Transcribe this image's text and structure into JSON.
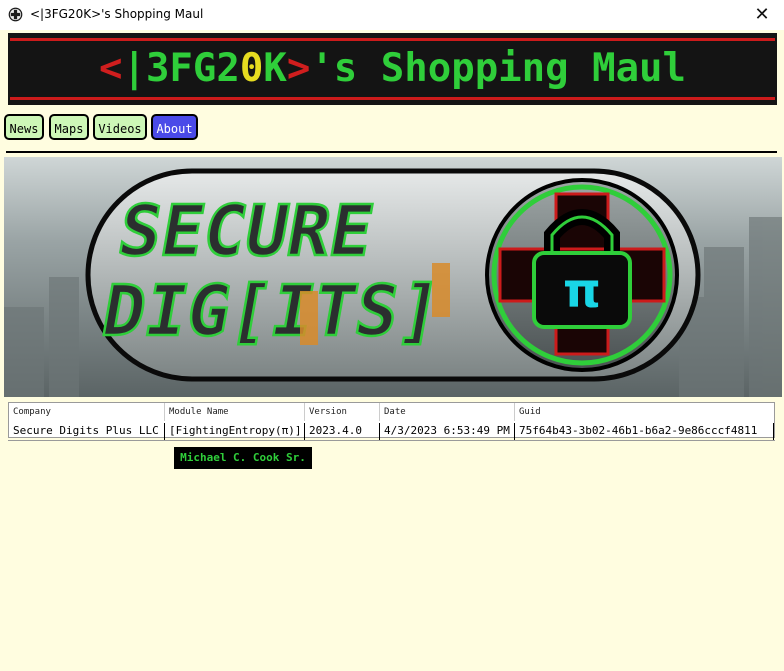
{
  "window": {
    "title": "<|3FG20K>'s Shopping Maul",
    "close_glyph": "✕",
    "icon": "cross-circle-icon"
  },
  "banner": {
    "part1": "<",
    "part2": "|3FG2",
    "part3": "0",
    "part4": "K",
    "part5": ">",
    "part6": "'s Shopping Maul"
  },
  "nav": {
    "items": [
      {
        "label": "News"
      },
      {
        "label": "Maps"
      },
      {
        "label": "Videos"
      },
      {
        "label": "About",
        "active": true
      }
    ]
  },
  "hero": {
    "logo_line1": "SECURE",
    "logo_line2": "DIG[ITS]",
    "pi_symbol": "π",
    "colors": {
      "accent_green": "#2fce3a",
      "accent_red": "#cc1b1b",
      "cyan": "#19d6e6",
      "orange": "#d88b2a"
    }
  },
  "grid": {
    "columns": [
      "Company",
      "Module Name",
      "Version",
      "Date",
      "Guid"
    ],
    "rows": [
      [
        "Secure Digits Plus LLC",
        "[FightingEntropy(π)]",
        "2023.4.0",
        "4/3/2023 6:53:49 PM",
        "75f64b43-3b02-46b1-b6a2-9e86cccf4811"
      ]
    ]
  },
  "author": "Michael C. Cook Sr.",
  "colors": {
    "background": "#fffde0",
    "banner_bg": "#141414",
    "nav_bg": "#cdf7b7",
    "nav_active": "#4a4ae8"
  }
}
